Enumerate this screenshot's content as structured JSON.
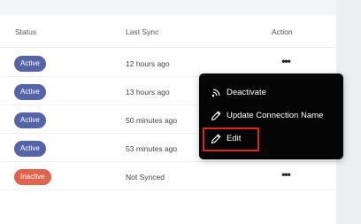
{
  "table": {
    "headers": {
      "status": "Status",
      "last_sync": "Last Sync",
      "action": "Action"
    },
    "rows": [
      {
        "status": "Active",
        "status_type": "active",
        "last_sync": "12 hours ago",
        "action": "•••"
      },
      {
        "status": "Active",
        "status_type": "active",
        "last_sync": "13 hours ago",
        "action": ""
      },
      {
        "status": "Active",
        "status_type": "active",
        "last_sync": "50 minutes ago",
        "action": ""
      },
      {
        "status": "Active",
        "status_type": "active",
        "last_sync": "53 minutes ago",
        "action": ""
      },
      {
        "status": "Inactive",
        "status_type": "inactive",
        "last_sync": "Not Synced",
        "action": "•••"
      }
    ]
  },
  "action_menu": {
    "items": [
      {
        "label": "Deactivate",
        "icon": "wireless-signal-icon"
      },
      {
        "label": "Update Connection Name",
        "icon": "pencil-icon"
      },
      {
        "label": "Edit",
        "icon": "pencil-icon"
      }
    ],
    "highlighted_item": "Edit"
  },
  "colors": {
    "active_badge": "#5464a8",
    "inactive_badge": "#e0634c",
    "menu_background": "#050505",
    "highlight_border": "#e0211e"
  }
}
